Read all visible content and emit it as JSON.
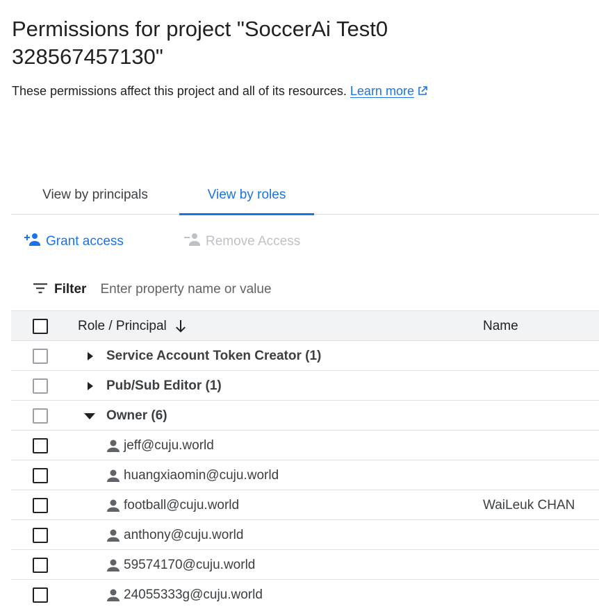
{
  "page": {
    "title": "Permissions for project \"SoccerAi Test0 328567457130\"",
    "description": "These permissions affect this project and all of its resources.",
    "learn_more": "Learn more"
  },
  "tabs": {
    "principals": "View by principals",
    "roles": "View by roles",
    "active": "roles"
  },
  "actions": {
    "grant": "Grant access",
    "remove": "Remove Access"
  },
  "filter": {
    "label": "Filter",
    "placeholder": "Enter property name or value"
  },
  "table": {
    "headers": {
      "role": "Role / Principal",
      "name": "Name"
    },
    "roles": [
      {
        "label": "Service Account Token Creator (1)",
        "expanded": false
      },
      {
        "label": "Pub/Sub Editor (1)",
        "expanded": false
      },
      {
        "label": "Owner (6)",
        "expanded": true
      }
    ],
    "principals": [
      {
        "email": "jeff@cuju.world",
        "name": ""
      },
      {
        "email": "huangxiaomin@cuju.world",
        "name": ""
      },
      {
        "email": "football@cuju.world",
        "name": "WaiLeuk CHAN"
      },
      {
        "email": "anthony@cuju.world",
        "name": ""
      },
      {
        "email": "59574170@cuju.world",
        "name": ""
      },
      {
        "email": "24055333g@cuju.world",
        "name": ""
      }
    ]
  },
  "colors": {
    "accent": "#1a73e8",
    "text": "#202124",
    "muted": "#5f6368",
    "disabled": "#bdc1c6",
    "header_bg": "#f1f3f4"
  }
}
